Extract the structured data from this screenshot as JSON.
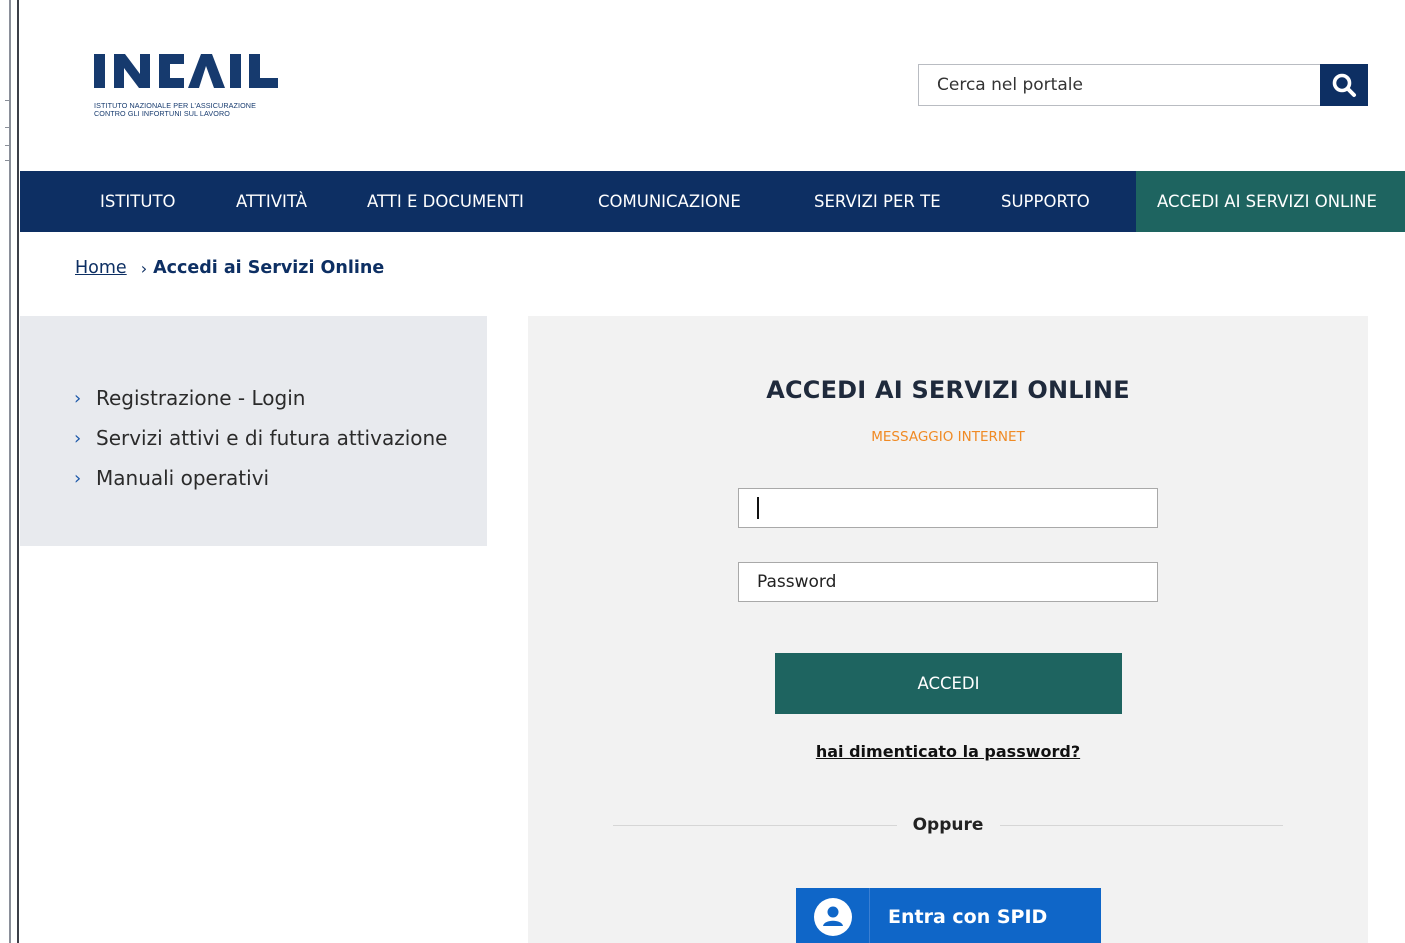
{
  "brand": {
    "logo_subtitle": "ISTITUTO NAZIONALE PER L'ASSICURAZIONE\nCONTRO GLI INFORTUNI SUL LAVORO",
    "primary_color": "#0d2f63",
    "accent_color": "#1e6460"
  },
  "search": {
    "placeholder": "Cerca nel portale",
    "icon": "search-icon"
  },
  "nav": {
    "items": [
      {
        "label": "ISTITUTO"
      },
      {
        "label": "ATTIVITÀ"
      },
      {
        "label": "ATTI E DOCUMENTI"
      },
      {
        "label": "COMUNICAZIONE"
      },
      {
        "label": "SERVIZI PER TE"
      },
      {
        "label": "SUPPORTO"
      }
    ],
    "active": {
      "label": "ACCEDI AI SERVIZI ONLINE"
    }
  },
  "breadcrumb": {
    "home": "Home",
    "separator": "›",
    "current": "Accedi ai Servizi Online"
  },
  "sidebar": {
    "items": [
      {
        "label": "Registrazione - Login"
      },
      {
        "label": "Servizi attivi e di futura attivazione"
      },
      {
        "label": "Manuali operativi"
      }
    ]
  },
  "login": {
    "title": "ACCEDI AI SERVIZI ONLINE",
    "message": "MESSAGGIO INTERNET",
    "message_color": "#f08a24",
    "username_value": "",
    "password_placeholder": "Password",
    "submit_label": "ACCEDI",
    "forgot_label": "hai dimenticato la password?",
    "divider_label": "Oppure",
    "spid_label": "Entra con SPID",
    "spid_color": "#0f66c8"
  }
}
